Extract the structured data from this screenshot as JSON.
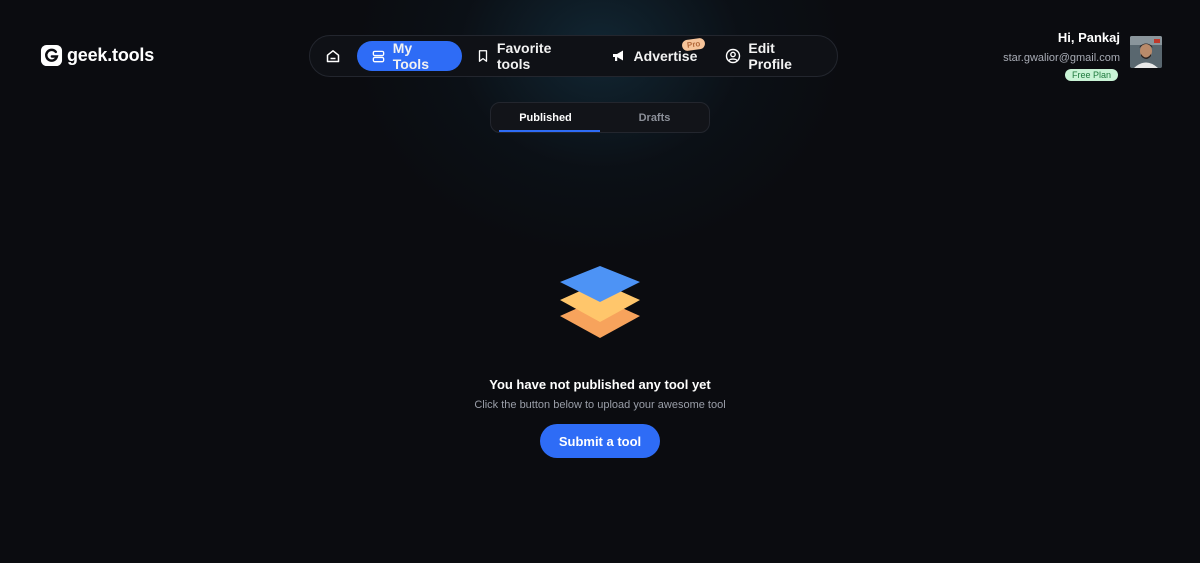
{
  "brand": {
    "name": "geek.tools"
  },
  "nav": {
    "home_icon": "home-icon",
    "items": [
      {
        "label": "My Tools",
        "icon": "stack-icon",
        "active": true
      },
      {
        "label": "Favorite tools",
        "icon": "bookmark-icon",
        "active": false
      },
      {
        "label": "Advertise",
        "icon": "megaphone-icon",
        "active": false,
        "badge": "Pro"
      },
      {
        "label": "Edit Profile",
        "icon": "user-circle-icon",
        "active": false
      }
    ]
  },
  "user": {
    "greeting": "Hi, Pankaj",
    "email": "star.gwalior@gmail.com",
    "plan": "Free Plan"
  },
  "tabs": [
    {
      "label": "Published",
      "active": true
    },
    {
      "label": "Drafts",
      "active": false
    }
  ],
  "empty_state": {
    "icon": "layers-icon",
    "title": "You have not published any tool yet",
    "subtitle": "Click the button below to upload your awesome tool",
    "button_label": "Submit a tool"
  },
  "colors": {
    "background": "#0b0c10",
    "accent": "#2e6cf6",
    "pro_badge": "#f6c49a",
    "plan_badge": "#c9f4d6"
  }
}
